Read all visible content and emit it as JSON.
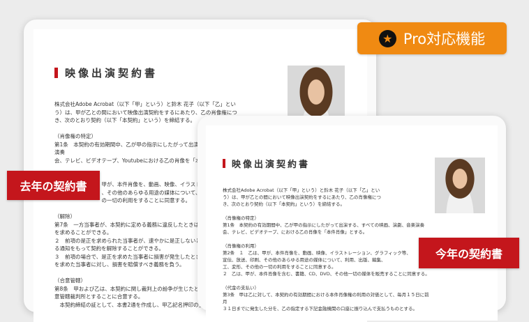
{
  "badge": {
    "icon": "star-icon",
    "label": "Pro対応機能",
    "color": "#f08a12"
  },
  "back_document": {
    "title": "映像出演契約書",
    "body": "株式会社Adobe Acrobat（以下「甲」という）と鈴木 花子（以下「乙」とい\nう）は、甲が乙との間において映像出演契約をするにあたり、乙の肖像権につ\nき、次のとおり契約（以下「本契約」という）を締結する。\n\n（肖像権の特定）\n第1条　本契約の有効期間中、乙が甲の指示にしたがって出演する、すべての映画、演劇、音楽演奏\n会、テレビ、ビデオテープ、Youtubeにおける乙の肖像を「本件肖像」とする。\n\n（肖像権の利用）\n　　　　　　　　　甲が、本件肖像を、動画、映像、イラストレーション、グラフィック等、\n　　　　　　　　　、その他のあらゆる用途の媒体について、利用、出版、編集、\n　　　　　　　　　の一切の利用をすることに同意する。\n\n（解除）\n第7条　一方当事者が、本契約に定める義務に違反したときは、相手方は書面にて是正\nを求めることができる。\n２　前項の是正を求められた当事者が、速やかに是正しないときは、相手方は書面によ\nる通知をもって契約を解除することができる。\n３　前項の場合で、是正を求めた当事者に損害が発生したときは、是正を求められた\nを求めた当事者に対し、損害を賠償すべき義務を負う。\n\n（合意管轄）\n第8条　甲および乙は、本契約に関し裁判上の紛争が生じたときは、東京地方裁判所を\n意管轄裁判所とすることに合意する。\n　本契約締結の証として、本書2通を作成し、甲乙記名押印の上、各1通を保有する。"
  },
  "front_document": {
    "title": "映像出演契約書",
    "body": "株式会社Adobe Acrobat（以下「甲」という）と鈴木 花子（以下「乙」とい\nう）は、甲が乙との間において映像出演契約をするにあたり、乙の肖像権につ\nき、次のとおり契約（以下「本契約」という）を締結する。\n\n（肖像権の特定）\n第1条　本契約の有効期間中、乙が甲の指示にしたがって出演する、すべての映画、演劇、音楽演奏\n会、テレビ、ビデオテープ、における乙の肖像を「本件肖像」とする。\n\n（肖像権の利用）\n第2条　１　乙は、甲が、本件肖像を、動画、映像、イラストレーション、グラフィック等、\n宣伝、放送、印刷、その他のあらゆる用途の媒体について、利用、出版、編集、\n工、変形、その他の一切の利用をすることに同意する。\n２　乙は、甲が、本件肖像を含む、書籍、CD、DVD、その他一切の媒体を販売することに同意する。\n\n（代金の支払い）\n第3条　甲は乙に対して、本契約の有効期間における本件肖像権の利用の対価として、毎月１５日に前月\n３１日までに発生した分を、乙の指定する下記金融機関の口座に振り込んで支払うものとする。"
  },
  "labels": {
    "last_year": "去年の契約書",
    "this_year": "今年の契約書",
    "color": "#c4161c"
  }
}
